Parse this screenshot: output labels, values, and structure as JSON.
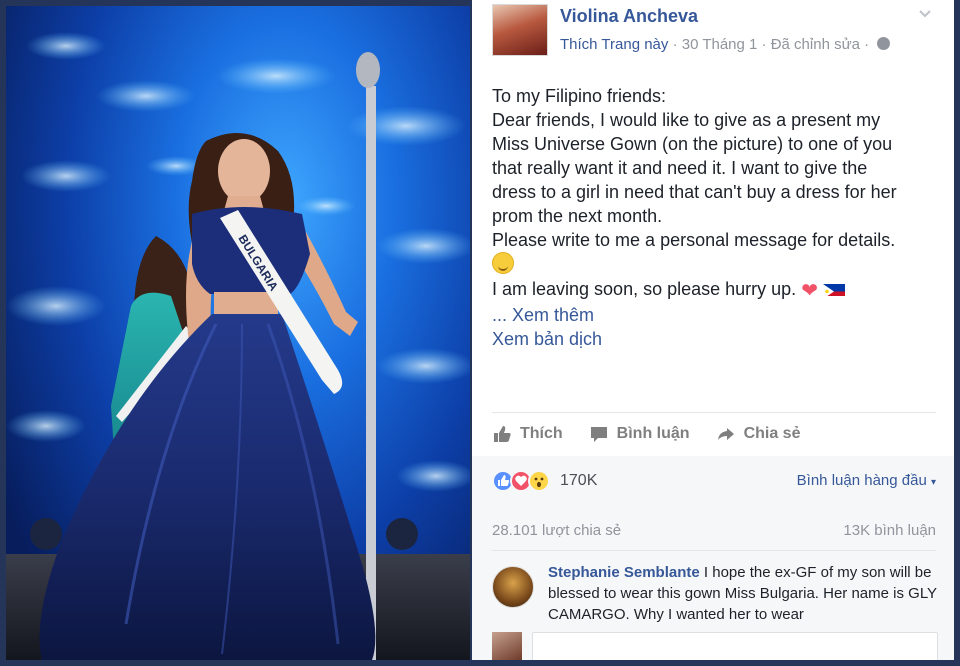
{
  "post": {
    "author": "Violina Ancheva",
    "like_page": "Thích Trang này",
    "date": "30 Tháng 1",
    "edited": "Đã chỉnh sửa",
    "text_lines": [
      "To my Filipino friends:",
      "Dear friends, I would like to give as a present my",
      "Miss Universe Gown (on the picture) to one of you",
      "that really want it and need it. I want to give the",
      "dress to a girl in need that can't buy a dress for her",
      "prom the next month.",
      "Please write to me a personal message for details."
    ],
    "closing_line": "I am leaving soon, so please hurry up.",
    "see_more": "... Xem thêm",
    "see_translation": "Xem bản dịch",
    "sash_text": "BULGARIA"
  },
  "actions": {
    "like": "Thích",
    "comment": "Bình luận",
    "share": "Chia sẻ"
  },
  "stats": {
    "reaction_count": "170K",
    "top_comments": "Bình luận hàng đầu",
    "shares": "28.101 lượt chia sẻ",
    "comments": "13K bình luận"
  },
  "comment": {
    "name": "Stephanie Semblante",
    "text": " I hope the ex-GF of my son will be blessed to wear this gown Miss Bulgaria. Her name is GLY CAMARGO. Why I wanted her to wear"
  },
  "icons": {
    "globe": "globe-icon",
    "chevron": "chevron-down-icon",
    "like": "thumbs-up-icon",
    "comment": "comment-bubble-icon",
    "share": "share-arrow-icon"
  },
  "colors": {
    "link": "#365899",
    "meta": "#90949c",
    "action": "#7f7f7f",
    "background": "#25355a"
  }
}
